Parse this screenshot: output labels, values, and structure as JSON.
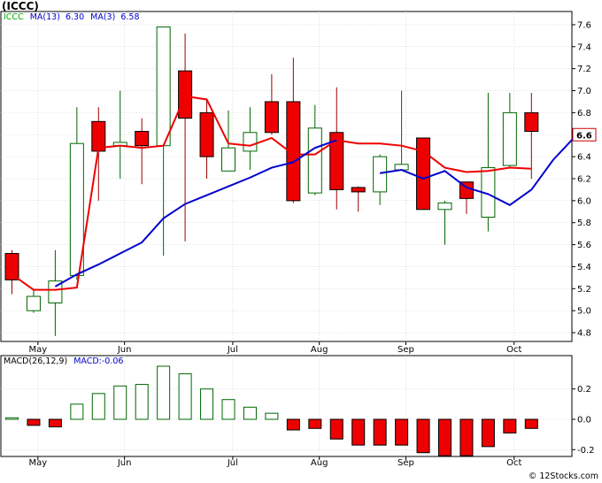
{
  "header": {
    "ticker": "(ICCC)",
    "legend": [
      {
        "text": "ICCC",
        "color": "#00aa00"
      },
      {
        "text": "MA(13)",
        "color": "#0000cc"
      },
      {
        "text": "6.30",
        "color": "#0000cc"
      },
      {
        "text": "MA(3)",
        "color": "#0000cc"
      },
      {
        "text": "6.58",
        "color": "#0000cc"
      }
    ]
  },
  "macd_legend": [
    {
      "text": "MACD(26,12,9)",
      "color": "#000000"
    },
    {
      "text": "MACD:-0.06",
      "color": "#0000cc"
    }
  ],
  "watermark": "© 12Stocks.com",
  "current_price_label": "6.6",
  "colors": {
    "up": "#ffffff",
    "up_border": "#006600",
    "down": "#ee0000",
    "ma13": "#0000cc",
    "ma3": "#ee0000",
    "macd_pos": "#ffffff",
    "macd_neg": "#ee0000",
    "grid": "#cccccc"
  },
  "chart_data": [
    {
      "type": "candlestick",
      "title": "(ICCC)",
      "ylim": [
        4.72,
        7.72
      ],
      "y_ticks": [
        "4.8",
        "5.0",
        "5.2",
        "5.4",
        "5.6",
        "5.8",
        "6.0",
        "6.2",
        "6.4",
        "6.6",
        "6.8",
        "7.0",
        "7.2",
        "7.4",
        "7.6"
      ],
      "x_ticks": [
        {
          "label": "May",
          "index": 1.2
        },
        {
          "label": "Jun",
          "index": 5.2
        },
        {
          "label": "Jul",
          "index": 10.2
        },
        {
          "label": "Aug",
          "index": 14.2
        },
        {
          "label": "Sep",
          "index": 18.2
        },
        {
          "label": "Oct",
          "index": 23.2
        }
      ],
      "candles": [
        {
          "open": 5.52,
          "high": 5.55,
          "low": 5.15,
          "close": 5.28
        },
        {
          "open": 5.0,
          "high": 5.2,
          "low": 4.98,
          "close": 5.13
        },
        {
          "open": 5.07,
          "high": 5.55,
          "low": 4.77,
          "close": 5.27
        },
        {
          "open": 5.32,
          "high": 6.85,
          "low": 5.28,
          "close": 6.52
        },
        {
          "open": 6.72,
          "high": 6.85,
          "low": 6.0,
          "close": 6.45
        },
        {
          "open": 6.5,
          "high": 7.0,
          "low": 6.2,
          "close": 6.53
        },
        {
          "open": 6.63,
          "high": 6.75,
          "low": 6.15,
          "close": 6.5
        },
        {
          "open": 6.5,
          "high": 7.58,
          "low": 5.5,
          "close": 7.58
        },
        {
          "open": 7.18,
          "high": 7.52,
          "low": 5.63,
          "close": 6.75
        },
        {
          "open": 6.8,
          "high": 6.92,
          "low": 6.2,
          "close": 6.4
        },
        {
          "open": 6.27,
          "high": 6.82,
          "low": 6.27,
          "close": 6.48
        },
        {
          "open": 6.45,
          "high": 6.85,
          "low": 6.28,
          "close": 6.62
        },
        {
          "open": 6.9,
          "high": 7.15,
          "low": 6.6,
          "close": 6.62
        },
        {
          "open": 6.9,
          "high": 7.3,
          "low": 5.98,
          "close": 6.0
        },
        {
          "open": 6.07,
          "high": 6.87,
          "low": 6.05,
          "close": 6.66
        },
        {
          "open": 6.62,
          "high": 7.03,
          "low": 5.92,
          "close": 6.1
        },
        {
          "open": 6.12,
          "high": 6.13,
          "low": 5.9,
          "close": 6.08
        },
        {
          "open": 6.08,
          "high": 6.42,
          "low": 5.96,
          "close": 6.4
        },
        {
          "open": 6.28,
          "high": 7.0,
          "low": 6.28,
          "close": 6.33
        },
        {
          "open": 6.57,
          "high": 6.57,
          "low": 5.92,
          "close": 5.92
        },
        {
          "open": 5.92,
          "high": 6.0,
          "low": 5.6,
          "close": 5.98
        },
        {
          "open": 6.17,
          "high": 6.17,
          "low": 5.88,
          "close": 6.02
        },
        {
          "open": 5.85,
          "high": 6.98,
          "low": 5.72,
          "close": 6.3
        },
        {
          "open": 6.32,
          "high": 6.98,
          "low": 6.3,
          "close": 6.8
        },
        {
          "open": 6.8,
          "high": 6.98,
          "low": 6.2,
          "close": 6.63
        }
      ],
      "ma13": {
        "name": "MA(13)",
        "start_index": 2,
        "values": [
          5.22,
          5.33,
          5.42,
          5.52,
          5.62,
          5.84,
          5.97,
          6.05,
          6.13,
          6.21,
          6.3,
          6.35,
          6.48,
          6.55,
          null,
          6.25,
          6.28,
          6.2,
          6.27,
          6.12,
          6.06,
          5.96,
          6.1,
          6.37,
          6.58
        ]
      },
      "ma3": {
        "name": "MA(3)",
        "start_index": 0,
        "values": [
          5.33,
          5.19,
          5.19,
          5.21,
          6.48,
          6.5,
          6.48,
          6.5,
          6.95,
          6.92,
          6.52,
          6.5,
          6.57,
          6.42,
          6.42,
          6.55,
          6.52,
          6.52,
          6.5,
          6.45,
          6.3,
          6.26,
          6.27,
          6.3,
          6.29
        ]
      }
    },
    {
      "type": "bar",
      "title": "MACD(26,12,9)",
      "ylim": [
        -0.245,
        0.42
      ],
      "y_ticks": [
        "-0.2",
        "0.0",
        "0.2"
      ],
      "x_ticks": [
        "May",
        "Jun",
        "Jul",
        "Aug",
        "Sep",
        "Oct"
      ],
      "values": [
        0.01,
        -0.04,
        -0.05,
        0.1,
        0.17,
        0.22,
        0.23,
        0.35,
        0.3,
        0.2,
        0.13,
        0.08,
        0.04,
        -0.07,
        -0.06,
        -0.13,
        -0.17,
        -0.17,
        -0.17,
        -0.22,
        -0.24,
        -0.24,
        -0.18,
        -0.09,
        -0.06
      ]
    }
  ]
}
